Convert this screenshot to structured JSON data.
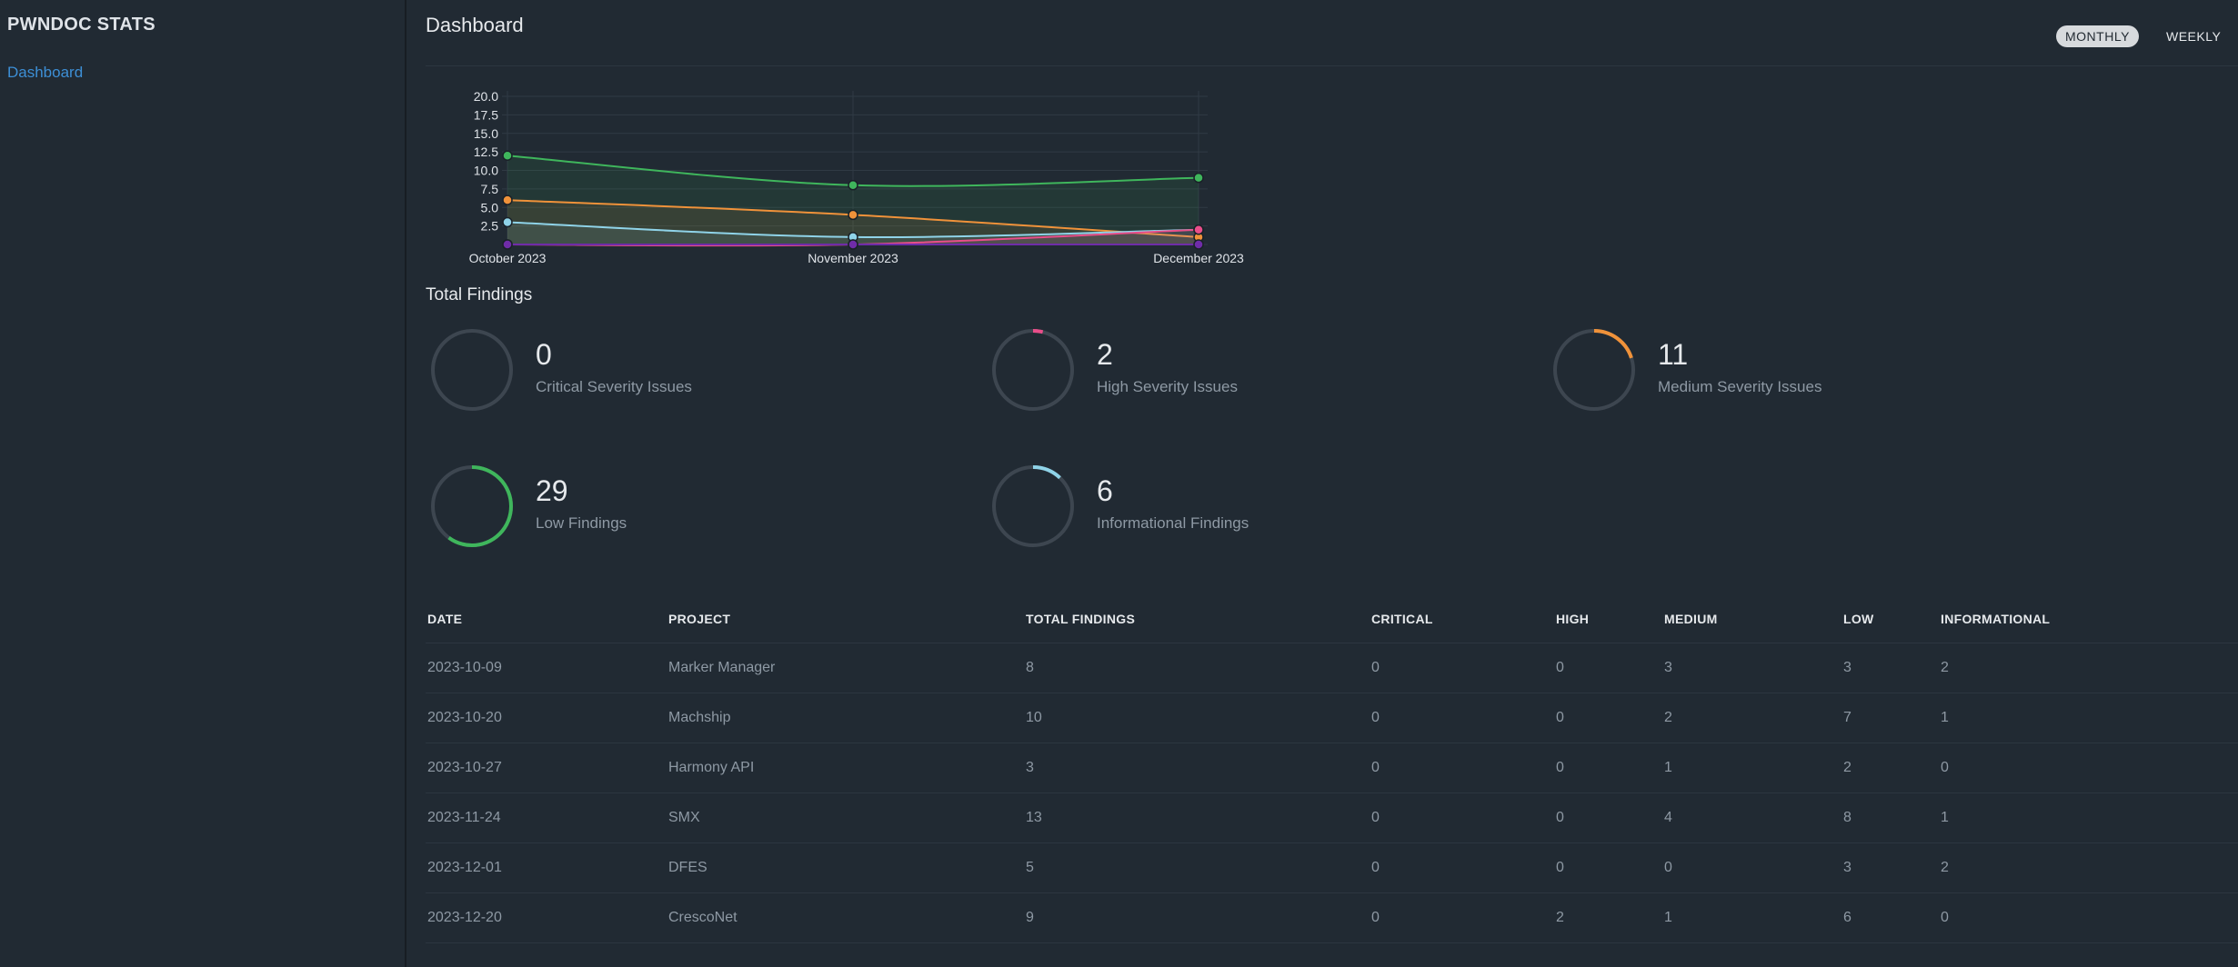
{
  "sidebar": {
    "brand": "PWNDOC STATS",
    "nav": [
      {
        "label": "Dashboard"
      }
    ]
  },
  "header": {
    "title": "Dashboard",
    "toggles": {
      "monthly": "MONTHLY",
      "weekly": "WEEKLY"
    }
  },
  "chart_data": {
    "type": "area",
    "categories": [
      "October 2023",
      "November 2023",
      "December 2023"
    ],
    "ylim": [
      0,
      20
    ],
    "yticks": [
      "20.0",
      "17.5",
      "15.0",
      "12.5",
      "10.0",
      "7.5",
      "5.0",
      "2.5"
    ],
    "grid": true,
    "series": [
      {
        "values": [
          12,
          8,
          9
        ],
        "color": "#3fb65c"
      },
      {
        "values": [
          6,
          4,
          1
        ],
        "color": "#f0923a"
      },
      {
        "values": [
          3,
          1,
          2
        ],
        "color": "#8fd3e8"
      },
      {
        "values": [
          0,
          0,
          2
        ],
        "color": "#e94e8a"
      },
      {
        "values": [
          0,
          0,
          0
        ],
        "color": "#6f2ca8"
      }
    ]
  },
  "summary": {
    "title": "Total Findings",
    "stats": [
      {
        "value": "0",
        "label": "Critical Severity Issues",
        "color": "#7b2fbf",
        "fraction": 0
      },
      {
        "value": "2",
        "label": "High Severity Issues",
        "color": "#e94e8a",
        "fraction": 0.04
      },
      {
        "value": "11",
        "label": "Medium Severity Issues",
        "color": "#f0923a",
        "fraction": 0.2
      },
      {
        "value": "29",
        "label": "Low Findings",
        "color": "#3fb65c",
        "fraction": 0.6
      },
      {
        "value": "6",
        "label": "Informational Findings",
        "color": "#8fd3e8",
        "fraction": 0.12
      }
    ]
  },
  "table": {
    "headers": [
      "DATE",
      "PROJECT",
      "TOTAL FINDINGS",
      "CRITICAL",
      "HIGH",
      "MEDIUM",
      "LOW",
      "INFORMATIONAL"
    ],
    "rows": [
      [
        "2023-10-09",
        "Marker Manager",
        "8",
        "0",
        "0",
        "3",
        "3",
        "2"
      ],
      [
        "2023-10-20",
        "Machship",
        "10",
        "0",
        "0",
        "2",
        "7",
        "1"
      ],
      [
        "2023-10-27",
        "Harmony API",
        "3",
        "0",
        "0",
        "1",
        "2",
        "0"
      ],
      [
        "2023-11-24",
        "SMX",
        "13",
        "0",
        "0",
        "4",
        "8",
        "1"
      ],
      [
        "2023-12-01",
        "DFES",
        "5",
        "0",
        "0",
        "0",
        "3",
        "2"
      ],
      [
        "2023-12-20",
        "CrescoNet",
        "9",
        "0",
        "2",
        "1",
        "6",
        "0"
      ]
    ]
  }
}
